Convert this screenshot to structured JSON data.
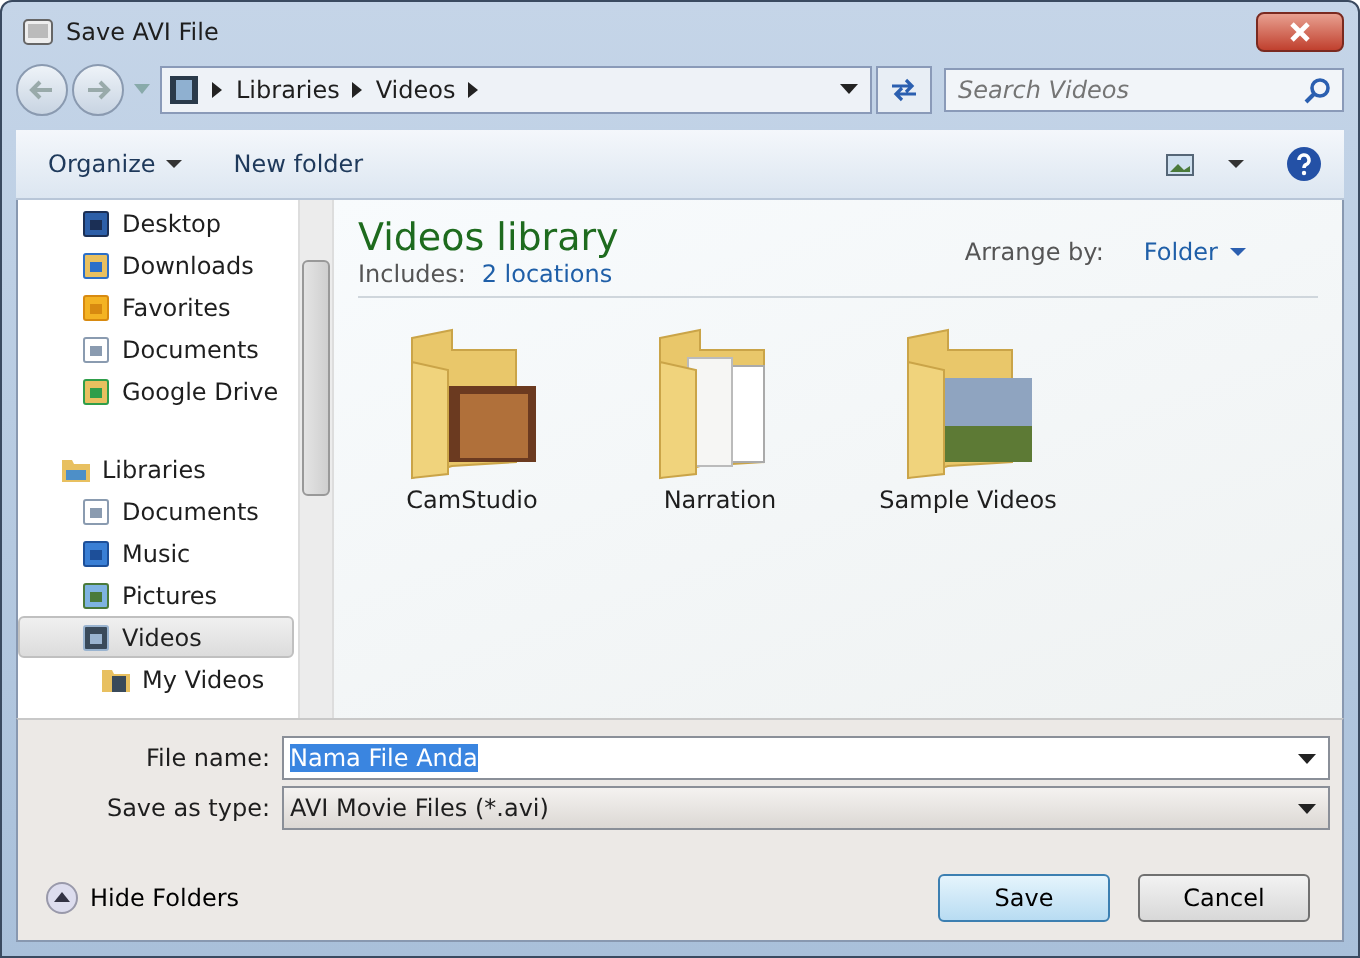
{
  "window": {
    "title": "Save AVI File"
  },
  "address": {
    "crumbs": [
      "Libraries",
      "Videos"
    ],
    "search_placeholder": "Search Videos"
  },
  "toolbar": {
    "organize": "Organize",
    "new_folder": "New folder"
  },
  "sidebar": {
    "groups": [
      {
        "children": [
          {
            "label": "Desktop",
            "selected": false
          },
          {
            "label": "Downloads",
            "selected": false
          },
          {
            "label": "Favorites",
            "selected": false
          },
          {
            "label": "Documents",
            "selected": false
          },
          {
            "label": "Google Drive",
            "selected": false
          }
        ]
      },
      {
        "label": "Libraries",
        "selected": false,
        "children": [
          {
            "label": "Documents",
            "selected": false
          },
          {
            "label": "Music",
            "selected": false
          },
          {
            "label": "Pictures",
            "selected": false
          },
          {
            "label": "Videos",
            "selected": true,
            "children": [
              {
                "label": "My Videos",
                "selected": false
              }
            ]
          }
        ]
      }
    ]
  },
  "library": {
    "title": "Videos library",
    "includes_label": "Includes:",
    "includes_link": "2 locations",
    "arrange_label": "Arrange by:",
    "arrange_value": "Folder"
  },
  "folders": [
    {
      "name": "CamStudio",
      "kind": "photo"
    },
    {
      "name": "Narration",
      "kind": "pages"
    },
    {
      "name": "Sample Videos",
      "kind": "landscape"
    }
  ],
  "form": {
    "file_name_label": "File name:",
    "file_name_value": "Nama File Anda",
    "type_label": "Save as type:",
    "type_value": "AVI Movie Files (*.avi)"
  },
  "footer": {
    "hide_folders": "Hide Folders",
    "buttons": [
      "Save",
      "Cancel"
    ]
  }
}
